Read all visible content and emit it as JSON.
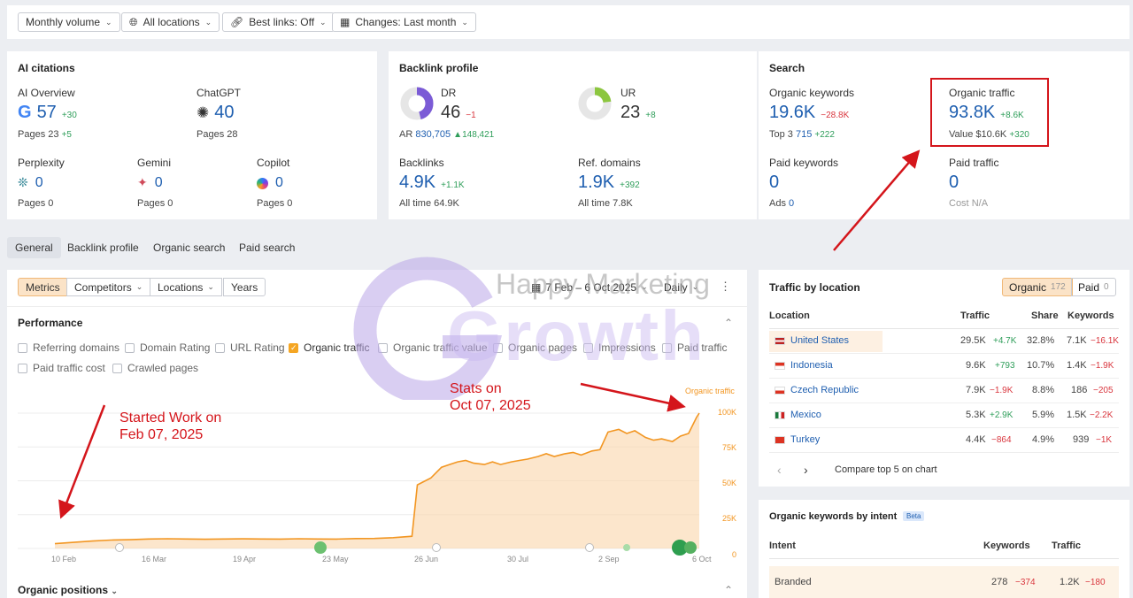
{
  "filters": {
    "volume": "Monthly volume",
    "locations": "All locations",
    "best_links": "Best links: Off",
    "changes": "Changes: Last month"
  },
  "ai_citations": {
    "title": "AI citations",
    "ai_overview": {
      "label": "AI Overview",
      "value": "57",
      "delta": "+30",
      "pages_label": "Pages",
      "pages": "23",
      "pages_delta": "+5"
    },
    "chatgpt": {
      "label": "ChatGPT",
      "value": "40",
      "pages_label": "Pages",
      "pages": "28"
    },
    "perplexity": {
      "label": "Perplexity",
      "value": "0",
      "pages_label": "Pages",
      "pages": "0"
    },
    "gemini": {
      "label": "Gemini",
      "value": "0",
      "pages_label": "Pages",
      "pages": "0"
    },
    "copilot": {
      "label": "Copilot",
      "value": "0",
      "pages_label": "Pages",
      "pages": "0"
    }
  },
  "backlink_profile": {
    "title": "Backlink profile",
    "dr": {
      "label": "DR",
      "value": "46",
      "delta": "−1",
      "fill_percent": 46
    },
    "ar": {
      "label": "AR",
      "value": "830,705",
      "delta": "▲148,421"
    },
    "ur": {
      "label": "UR",
      "value": "23",
      "delta": "+8",
      "fill_percent": 23
    },
    "backlinks": {
      "label": "Backlinks",
      "value": "4.9K",
      "delta": "+1.1K",
      "all_time_label": "All time",
      "all_time": "64.9K"
    },
    "ref_domains": {
      "label": "Ref. domains",
      "value": "1.9K",
      "delta": "+392",
      "all_time_label": "All time",
      "all_time": "7.8K"
    }
  },
  "search": {
    "title": "Search",
    "organic_keywords": {
      "label": "Organic keywords",
      "value": "19.6K",
      "delta": "−28.8K",
      "top3_label": "Top 3",
      "top3": "715",
      "top3_delta": "+222"
    },
    "organic_traffic": {
      "label": "Organic traffic",
      "value": "93.8K",
      "delta": "+8.6K",
      "value_label": "Value",
      "money": "$10.6K",
      "money_delta": "+320"
    },
    "paid_keywords": {
      "label": "Paid keywords",
      "value": "0",
      "ads_label": "Ads",
      "ads": "0"
    },
    "paid_traffic": {
      "label": "Paid traffic",
      "value": "0",
      "cost_label": "Cost",
      "cost": "N/A"
    }
  },
  "tabs": [
    "General",
    "Backlink profile",
    "Organic search",
    "Paid search"
  ],
  "performance": {
    "segments": [
      "Metrics",
      "Competitors",
      "Locations",
      "Years"
    ],
    "date_range": "7 Feb – 6 Oct 2025",
    "granularity": "Daily",
    "title": "Performance",
    "checkboxes": [
      {
        "label": "Referring domains",
        "checked": false
      },
      {
        "label": "Domain Rating",
        "checked": false
      },
      {
        "label": "URL Rating",
        "checked": false
      },
      {
        "label": "Organic traffic",
        "checked": true
      },
      {
        "label": "Organic traffic value",
        "checked": false
      },
      {
        "label": "Organic pages",
        "checked": false
      },
      {
        "label": "Impressions",
        "checked": false
      },
      {
        "label": "Paid traffic",
        "checked": false
      },
      {
        "label": "Paid traffic cost",
        "checked": false
      },
      {
        "label": "Crawled pages",
        "checked": false
      }
    ],
    "organic_positions": "Organic positions"
  },
  "chart_data": {
    "type": "area",
    "series": [
      {
        "name": "Organic traffic",
        "color": "#f29622"
      }
    ],
    "x_ticks": [
      "10 Feb",
      "16 Mar",
      "19 Apr",
      "23 May",
      "26 Jun",
      "30 Jul",
      "2 Sep",
      "6 Oct"
    ],
    "y_ticks": [
      "100K",
      "75K",
      "50K",
      "25K",
      "0"
    ],
    "ylim": [
      0,
      100000
    ],
    "x_days": [
      0,
      7,
      14,
      21,
      28,
      35,
      42,
      49,
      56,
      63,
      70,
      77,
      84,
      91,
      98,
      105,
      112,
      119,
      126,
      133,
      135,
      137,
      140,
      142,
      144,
      147,
      150,
      153,
      156,
      160,
      163,
      166,
      170,
      173,
      176,
      180,
      183,
      186,
      190,
      193,
      196,
      200,
      203,
      206,
      210,
      213,
      216,
      220,
      223,
      226,
      230,
      233,
      236,
      239,
      240
    ],
    "y": [
      3500,
      4500,
      5500,
      6200,
      6500,
      7000,
      7200,
      7000,
      6800,
      7000,
      7100,
      7000,
      6900,
      7200,
      7000,
      6900,
      7300,
      7400,
      8000,
      9000,
      47000,
      49000,
      52000,
      56000,
      60000,
      62000,
      64000,
      65000,
      63000,
      62000,
      64000,
      62000,
      64000,
      65000,
      66000,
      68000,
      70000,
      68000,
      70000,
      71000,
      69000,
      72000,
      73000,
      86000,
      88000,
      85000,
      87000,
      82000,
      80000,
      81000,
      79000,
      83000,
      85000,
      97000,
      100000
    ],
    "legend": "Organic traffic"
  },
  "traffic_by_location": {
    "title": "Traffic by location",
    "organic_label": "Organic",
    "organic_count": "172",
    "paid_label": "Paid",
    "paid_count": "0",
    "headers": [
      "Location",
      "Traffic",
      "Share",
      "Keywords"
    ],
    "rows": [
      {
        "country": "United States",
        "traffic": "29.5K",
        "delta": "+4.7K",
        "share": "32.8%",
        "keywords": "7.1K",
        "kdelta": "−16.1K"
      },
      {
        "country": "Indonesia",
        "traffic": "9.6K",
        "delta": "+793",
        "share": "10.7%",
        "keywords": "1.4K",
        "kdelta": "−1.9K"
      },
      {
        "country": "Czech Republic",
        "traffic": "7.9K",
        "delta": "−1.9K",
        "share": "8.8%",
        "keywords": "186",
        "kdelta": "−205"
      },
      {
        "country": "Mexico",
        "traffic": "5.3K",
        "delta": "+2.9K",
        "share": "5.9%",
        "keywords": "1.5K",
        "kdelta": "−2.2K"
      },
      {
        "country": "Turkey",
        "traffic": "4.4K",
        "delta": "−864",
        "share": "4.9%",
        "keywords": "939",
        "kdelta": "−1K"
      }
    ],
    "compare": "Compare top 5 on chart"
  },
  "keywords_by_intent": {
    "title": "Organic keywords by intent",
    "beta": "Beta",
    "headers": [
      "Intent",
      "Keywords",
      "Traffic"
    ],
    "rows": [
      {
        "intent": "Branded",
        "keywords": "278",
        "kdelta": "−374",
        "traffic": "1.2K",
        "tdelta": "−180"
      }
    ]
  },
  "annotations": {
    "start": "Started Work on\nFeb 07, 2025",
    "stats": "Stats on\nOct 07, 2025",
    "watermark": "Happy Marketing",
    "watermark_big": "Growth"
  }
}
